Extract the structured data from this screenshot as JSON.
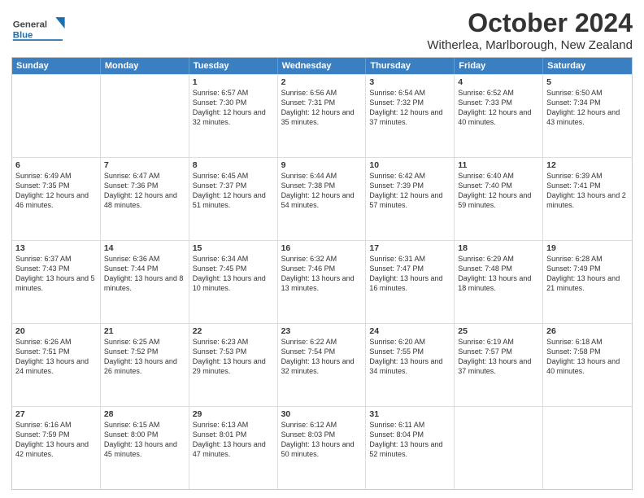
{
  "header": {
    "logo_general": "General",
    "logo_blue": "Blue",
    "title": "October 2024",
    "subtitle": "Witherlea, Marlborough, New Zealand"
  },
  "weekdays": [
    "Sunday",
    "Monday",
    "Tuesday",
    "Wednesday",
    "Thursday",
    "Friday",
    "Saturday"
  ],
  "rows": [
    [
      {
        "day": "",
        "info": ""
      },
      {
        "day": "",
        "info": ""
      },
      {
        "day": "1",
        "info": "Sunrise: 6:57 AM\nSunset: 7:30 PM\nDaylight: 12 hours and 32 minutes."
      },
      {
        "day": "2",
        "info": "Sunrise: 6:56 AM\nSunset: 7:31 PM\nDaylight: 12 hours and 35 minutes."
      },
      {
        "day": "3",
        "info": "Sunrise: 6:54 AM\nSunset: 7:32 PM\nDaylight: 12 hours and 37 minutes."
      },
      {
        "day": "4",
        "info": "Sunrise: 6:52 AM\nSunset: 7:33 PM\nDaylight: 12 hours and 40 minutes."
      },
      {
        "day": "5",
        "info": "Sunrise: 6:50 AM\nSunset: 7:34 PM\nDaylight: 12 hours and 43 minutes."
      }
    ],
    [
      {
        "day": "6",
        "info": "Sunrise: 6:49 AM\nSunset: 7:35 PM\nDaylight: 12 hours and 46 minutes."
      },
      {
        "day": "7",
        "info": "Sunrise: 6:47 AM\nSunset: 7:36 PM\nDaylight: 12 hours and 48 minutes."
      },
      {
        "day": "8",
        "info": "Sunrise: 6:45 AM\nSunset: 7:37 PM\nDaylight: 12 hours and 51 minutes."
      },
      {
        "day": "9",
        "info": "Sunrise: 6:44 AM\nSunset: 7:38 PM\nDaylight: 12 hours and 54 minutes."
      },
      {
        "day": "10",
        "info": "Sunrise: 6:42 AM\nSunset: 7:39 PM\nDaylight: 12 hours and 57 minutes."
      },
      {
        "day": "11",
        "info": "Sunrise: 6:40 AM\nSunset: 7:40 PM\nDaylight: 12 hours and 59 minutes."
      },
      {
        "day": "12",
        "info": "Sunrise: 6:39 AM\nSunset: 7:41 PM\nDaylight: 13 hours and 2 minutes."
      }
    ],
    [
      {
        "day": "13",
        "info": "Sunrise: 6:37 AM\nSunset: 7:43 PM\nDaylight: 13 hours and 5 minutes."
      },
      {
        "day": "14",
        "info": "Sunrise: 6:36 AM\nSunset: 7:44 PM\nDaylight: 13 hours and 8 minutes."
      },
      {
        "day": "15",
        "info": "Sunrise: 6:34 AM\nSunset: 7:45 PM\nDaylight: 13 hours and 10 minutes."
      },
      {
        "day": "16",
        "info": "Sunrise: 6:32 AM\nSunset: 7:46 PM\nDaylight: 13 hours and 13 minutes."
      },
      {
        "day": "17",
        "info": "Sunrise: 6:31 AM\nSunset: 7:47 PM\nDaylight: 13 hours and 16 minutes."
      },
      {
        "day": "18",
        "info": "Sunrise: 6:29 AM\nSunset: 7:48 PM\nDaylight: 13 hours and 18 minutes."
      },
      {
        "day": "19",
        "info": "Sunrise: 6:28 AM\nSunset: 7:49 PM\nDaylight: 13 hours and 21 minutes."
      }
    ],
    [
      {
        "day": "20",
        "info": "Sunrise: 6:26 AM\nSunset: 7:51 PM\nDaylight: 13 hours and 24 minutes."
      },
      {
        "day": "21",
        "info": "Sunrise: 6:25 AM\nSunset: 7:52 PM\nDaylight: 13 hours and 26 minutes."
      },
      {
        "day": "22",
        "info": "Sunrise: 6:23 AM\nSunset: 7:53 PM\nDaylight: 13 hours and 29 minutes."
      },
      {
        "day": "23",
        "info": "Sunrise: 6:22 AM\nSunset: 7:54 PM\nDaylight: 13 hours and 32 minutes."
      },
      {
        "day": "24",
        "info": "Sunrise: 6:20 AM\nSunset: 7:55 PM\nDaylight: 13 hours and 34 minutes."
      },
      {
        "day": "25",
        "info": "Sunrise: 6:19 AM\nSunset: 7:57 PM\nDaylight: 13 hours and 37 minutes."
      },
      {
        "day": "26",
        "info": "Sunrise: 6:18 AM\nSunset: 7:58 PM\nDaylight: 13 hours and 40 minutes."
      }
    ],
    [
      {
        "day": "27",
        "info": "Sunrise: 6:16 AM\nSunset: 7:59 PM\nDaylight: 13 hours and 42 minutes."
      },
      {
        "day": "28",
        "info": "Sunrise: 6:15 AM\nSunset: 8:00 PM\nDaylight: 13 hours and 45 minutes."
      },
      {
        "day": "29",
        "info": "Sunrise: 6:13 AM\nSunset: 8:01 PM\nDaylight: 13 hours and 47 minutes."
      },
      {
        "day": "30",
        "info": "Sunrise: 6:12 AM\nSunset: 8:03 PM\nDaylight: 13 hours and 50 minutes."
      },
      {
        "day": "31",
        "info": "Sunrise: 6:11 AM\nSunset: 8:04 PM\nDaylight: 13 hours and 52 minutes."
      },
      {
        "day": "",
        "info": ""
      },
      {
        "day": "",
        "info": ""
      }
    ]
  ]
}
